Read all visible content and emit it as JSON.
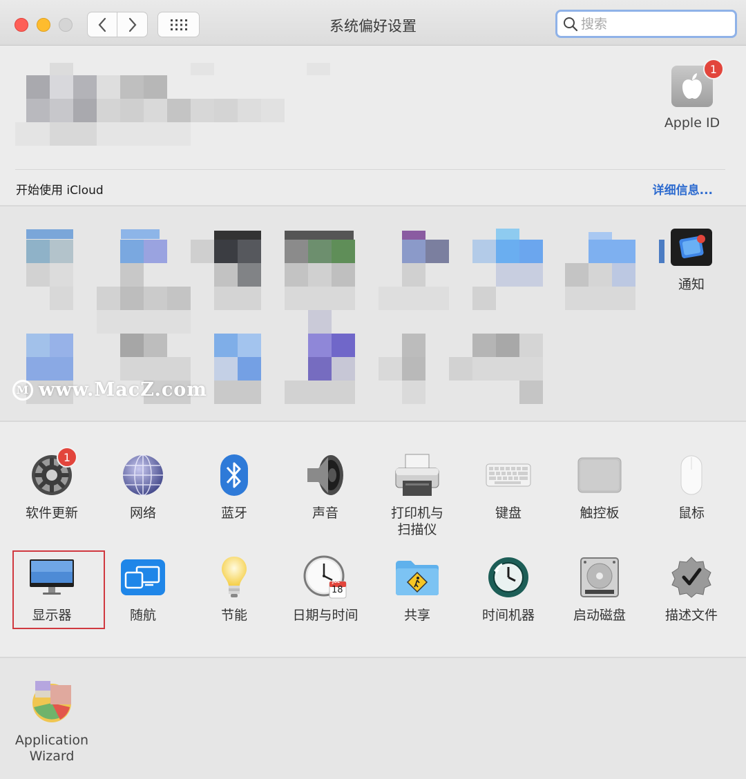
{
  "window": {
    "title": "系统偏好设置"
  },
  "toolbar": {
    "search_placeholder": "搜索",
    "back_icon": "chevron-left-icon",
    "forward_icon": "chevron-right-icon",
    "grid_icon": "grid-icon"
  },
  "account": {
    "apple_id_label": "Apple ID",
    "apple_id_badge": "1",
    "icloud_prompt": "开始使用 iCloud",
    "details_link": "详细信息..."
  },
  "blurred_section": {
    "notifications_label": "通知",
    "watermark": "www.MacZ.com"
  },
  "prefs": [
    {
      "id": "software-update",
      "label": "软件更新",
      "icon": "gear-icon",
      "badge": "1"
    },
    {
      "id": "network",
      "label": "网络",
      "icon": "globe-icon"
    },
    {
      "id": "bluetooth",
      "label": "蓝牙",
      "icon": "bluetooth-icon"
    },
    {
      "id": "sound",
      "label": "声音",
      "icon": "speaker-icon"
    },
    {
      "id": "printers",
      "label": "打印机与\n扫描仪",
      "label_line1": "打印机与",
      "label_line2": "扫描仪",
      "icon": "printer-icon"
    },
    {
      "id": "keyboard",
      "label": "键盘",
      "icon": "keyboard-icon"
    },
    {
      "id": "trackpad",
      "label": "触控板",
      "icon": "trackpad-icon"
    },
    {
      "id": "mouse",
      "label": "鼠标",
      "icon": "mouse-icon"
    },
    {
      "id": "displays",
      "label": "显示器",
      "icon": "display-icon",
      "selected": true
    },
    {
      "id": "sidecar",
      "label": "随航",
      "icon": "sidecar-icon"
    },
    {
      "id": "energy-saver",
      "label": "节能",
      "icon": "lightbulb-icon"
    },
    {
      "id": "date-time",
      "label": "日期与时间",
      "icon": "clock-icon",
      "calendar_month": "JUL",
      "calendar_day": "18"
    },
    {
      "id": "sharing",
      "label": "共享",
      "icon": "sharing-folder-icon"
    },
    {
      "id": "time-machine",
      "label": "时间机器",
      "icon": "time-machine-icon"
    },
    {
      "id": "startup-disk",
      "label": "启动磁盘",
      "icon": "hard-disk-icon"
    },
    {
      "id": "profiles",
      "label": "描述文件",
      "icon": "checkmark-badge-icon"
    }
  ],
  "other": {
    "app_wizard_line1": "Application",
    "app_wizard_line2": "Wizard",
    "app_wizard_icon": "application-wizard-icon"
  },
  "colors": {
    "accent": "#2d6bcf",
    "badge": "#e2453c",
    "selection_border": "#d0383f"
  }
}
